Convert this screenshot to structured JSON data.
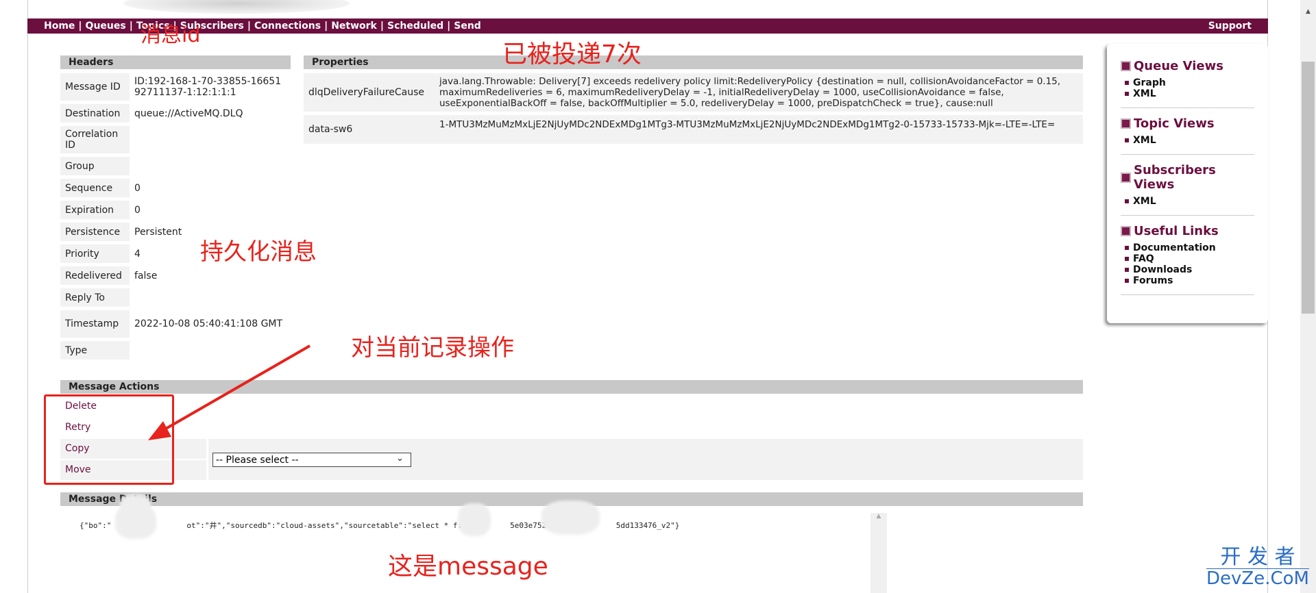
{
  "nav": {
    "items": [
      "Home",
      "Queues",
      "Topics",
      "Subscribers",
      "Connections",
      "Network",
      "Scheduled",
      "Send"
    ],
    "support": "Support"
  },
  "headers": {
    "title": "Headers",
    "rows": [
      {
        "k": "Message ID",
        "v": "ID:192-168-1-70-33855-1665192711137-1:12:1:1:1"
      },
      {
        "k": "Destination",
        "v": "queue://ActiveMQ.DLQ"
      },
      {
        "k": "Correlation ID",
        "v": ""
      },
      {
        "k": "Group",
        "v": ""
      },
      {
        "k": "Sequence",
        "v": "0"
      },
      {
        "k": "Expiration",
        "v": "0"
      },
      {
        "k": "Persistence",
        "v": "Persistent"
      },
      {
        "k": "Priority",
        "v": "4"
      },
      {
        "k": "Redelivered",
        "v": "false"
      },
      {
        "k": "Reply To",
        "v": ""
      },
      {
        "k": "Timestamp",
        "v": "2022-10-08 05:40:41:108 GMT"
      },
      {
        "k": "Type",
        "v": ""
      }
    ]
  },
  "properties": {
    "title": "Properties",
    "rows": [
      {
        "k": "dlqDeliveryFailureCause",
        "v": "java.lang.Throwable: Delivery[7] exceeds redelivery policy limit:RedeliveryPolicy {destination = null, collisionAvoidanceFactor = 0.15, maximumRedeliveries = 6, maximumRedeliveryDelay = -1, initialRedeliveryDelay = 1000, useCollisionAvoidance = false, useExponentialBackOff = false, backOffMultiplier = 5.0, redeliveryDelay = 1000, preDispatchCheck = true}, cause:null"
      },
      {
        "k": "data-sw6",
        "v": "1-MTU3MzMuMzMxLjE2NjUyMDc2NDExMDg1MTg3-MTU3MzMuMzMxLjE2NjUyMDc2NDExMDg1MTg2-0-15733-15733-Mjk=-LTE=-LTE="
      }
    ]
  },
  "actions": {
    "title": "Message Actions",
    "delete": "Delete",
    "retry": "Retry",
    "copy": "Copy",
    "move": "Move",
    "select_value": "-- Please select --"
  },
  "details": {
    "title": "Message Details",
    "body_parts": [
      "{\"bo\":\"",
      "ot\":\"井\",\"sourcedb\":\"cloud-assets\",\"sourcetable\":\"select * f:",
      "5e03e7520",
      "5dd133476_v2\"}"
    ]
  },
  "sidebar": [
    {
      "title": "Queue Views",
      "items": [
        "Graph",
        "XML"
      ]
    },
    {
      "title": "Topic Views",
      "items": [
        "XML"
      ]
    },
    {
      "title": "Subscribers Views",
      "items": [
        "XML"
      ]
    },
    {
      "title": "Useful Links",
      "items": [
        "Documentation",
        "FAQ",
        "Downloads",
        "Forums"
      ]
    }
  ],
  "annotations": {
    "msg_id": "消息id",
    "delivered": "已被投递7次",
    "persistent": "持久化消息",
    "operate": "对当前记录操作",
    "this_message": "这是message",
    "color": "#e8221c"
  },
  "watermark": {
    "line1": "开 发 者",
    "line2": "DevZe.CoM"
  }
}
